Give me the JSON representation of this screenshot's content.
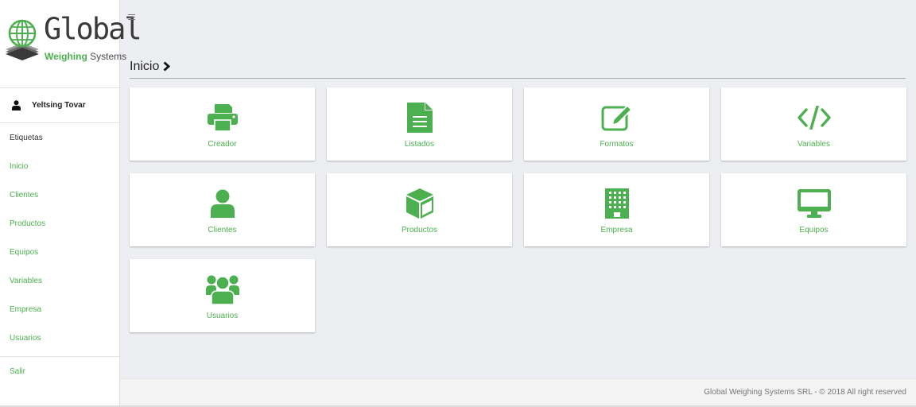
{
  "brand": {
    "name": "Global",
    "tagline_bold": "Weighing",
    "tagline_rest": " Systems",
    "logo_icon": "globe-scale-logo-icon",
    "accent_color": "#4caf50"
  },
  "user": {
    "name": "Yeltsing Tovar",
    "icon": "user-icon"
  },
  "sidebar": {
    "items": [
      {
        "label": "Etiquetas"
      },
      {
        "label": "Inicio"
      },
      {
        "label": "Clientes"
      },
      {
        "label": "Productos"
      },
      {
        "label": "Equipos"
      },
      {
        "label": "Variables"
      },
      {
        "label": "Empresa"
      },
      {
        "label": "Usuarios"
      }
    ],
    "logout": "Salir"
  },
  "header": {
    "menu_icon": "hamburger-menu-icon"
  },
  "breadcrumb": {
    "title": "Inicio",
    "icon": "chevron-right-icon"
  },
  "cards": [
    {
      "label": "Creador",
      "icon": "printer-icon"
    },
    {
      "label": "Listados",
      "icon": "document-icon"
    },
    {
      "label": "Formatos",
      "icon": "edit-icon"
    },
    {
      "label": "Variables",
      "icon": "code-icon"
    },
    {
      "label": "Clientes",
      "icon": "user-icon"
    },
    {
      "label": "Productos",
      "icon": "cube-icon"
    },
    {
      "label": "Empresa",
      "icon": "building-icon"
    },
    {
      "label": "Equipos",
      "icon": "desktop-icon"
    },
    {
      "label": "Usuarios",
      "icon": "users-icon"
    }
  ],
  "footer": {
    "text": "Global Weighing Systems SRL - © 2018 All right reserved"
  }
}
